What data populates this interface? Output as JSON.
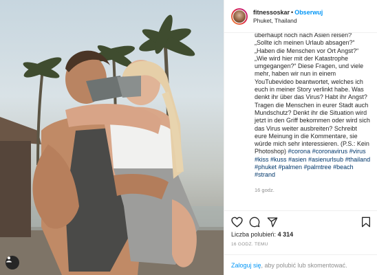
{
  "post": {
    "username": "fitnessoskar",
    "separator": "•",
    "follow_label": "Obserwuj",
    "location": "Phuket, Thailand"
  },
  "caption": {
    "text": "überhaupt noch nach Asien reisen? „Sollte ich meinen Urlaub absagen?“ „Haben die Menschen vor Ort Angst?“ „Wie wird hier mit der Katastrophe umgegangen?“ Diese Fragen, und viele mehr, haben wir nun in einem YouTubevideo beantwortet, welches ich euch in meiner Story verlinkt habe. Was denkt ihr über das Virus? Habt ihr Angst? Tragen die Menschen in eurer Stadt auch Mundschutz? Denkt ihr die Situation wird jetzt in den Griff bekommen oder wird sich das Virus weiter ausbreiten? Schreibt eure Meinung in die Kommentare, sie würde mich sehr interessieren. (P.S.: Kein Photoshop) ",
    "hashtags": "#corona #coronavirus #virus #kiss #kuss #asien #asienurlsub #thailand #phuket #palmen #palmtree #beach #strand",
    "time": "16 godz."
  },
  "likes": {
    "label": "Liczba polubień:",
    "count": "4 314"
  },
  "date_label": "16 GODZ. TEMU",
  "login": {
    "link": "Zaloguj się",
    "rest": ", aby polubić lub skomentować."
  }
}
